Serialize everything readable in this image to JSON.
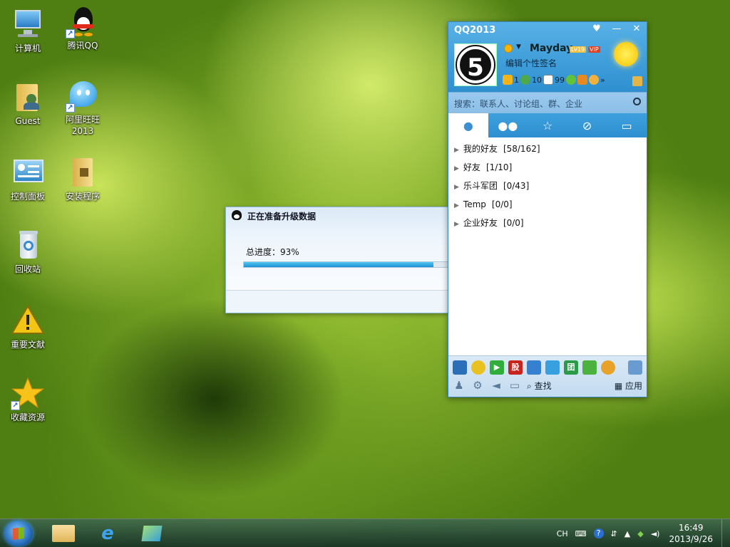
{
  "desktop": {
    "icons": [
      {
        "label": "计算机",
        "icon": "computer-icon"
      },
      {
        "label": "腾讯QQ",
        "icon": "qq-penguin-icon"
      },
      {
        "label": "Guest",
        "icon": "user-folder-icon"
      },
      {
        "label": "阿里旺旺2013",
        "icon": "aliwangwang-icon"
      },
      {
        "label": "控制面板",
        "icon": "control-panel-icon"
      },
      {
        "label": "安装程序",
        "icon": "installer-folder-icon"
      },
      {
        "label": "回收站",
        "icon": "recycle-bin-icon"
      },
      {
        "label": "重要文献",
        "icon": "warning-icon"
      },
      {
        "label": "收藏资源",
        "icon": "star-icon"
      }
    ]
  },
  "qq": {
    "title": "QQ2013",
    "nickname": "Mayday",
    "level_badge": "LV19",
    "vip_badge": "VIP",
    "signature": "编辑个性签名",
    "avatar_text": "5",
    "header_counts": {
      "stars": "1",
      "chat": "10",
      "mail": "99"
    },
    "search_placeholder": "搜索：联系人、讨论组、群、企业",
    "tabs": [
      {
        "name": "contacts",
        "icon": "person-icon"
      },
      {
        "name": "groups",
        "icon": "people-icon"
      },
      {
        "name": "favorites",
        "icon": "star-icon"
      },
      {
        "name": "qzone",
        "icon": "qzone-icon"
      },
      {
        "name": "recent",
        "icon": "chat-bubble-icon"
      }
    ],
    "groups": [
      {
        "name": "我的好友",
        "count": "[58/162]"
      },
      {
        "name": "好友",
        "count": "[1/10]"
      },
      {
        "name": "乐斗军团",
        "count": "[0/43]"
      },
      {
        "name": "Temp",
        "count": "[0/0]"
      },
      {
        "name": "企业好友",
        "count": "[0/0]"
      }
    ],
    "footer": {
      "find_label": "查找",
      "apps_label": "应用",
      "stock_label": "股",
      "group_label": "团"
    }
  },
  "upgrade": {
    "title": "正在准备升级数据",
    "progress_label": "总进度：93%",
    "progress_fraction": 0.93
  },
  "taskbar": {
    "lang": "CH",
    "time": "16:49",
    "date": "2013/9/26"
  },
  "colors": {
    "qq_header": "#3d9ad8",
    "progress_fill": "#1c8fd3",
    "taskbar": "#2b4a44"
  }
}
